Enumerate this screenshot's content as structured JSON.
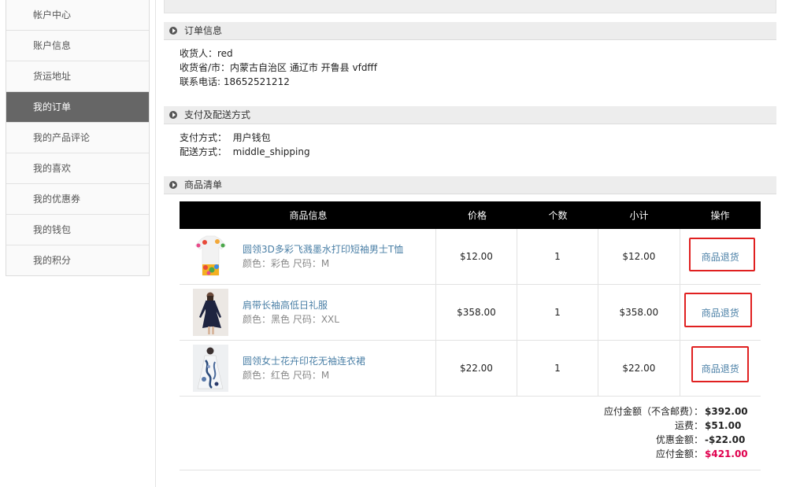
{
  "sidebar": {
    "items": [
      {
        "label": "帐户中心"
      },
      {
        "label": "账户信息"
      },
      {
        "label": "货运地址"
      },
      {
        "label": "我的订单"
      },
      {
        "label": "我的产品评论"
      },
      {
        "label": "我的喜欢"
      },
      {
        "label": "我的优惠券"
      },
      {
        "label": "我的钱包"
      },
      {
        "label": "我的积分"
      }
    ],
    "active": "我的订单"
  },
  "order_info": {
    "title": "订单信息",
    "consignee": "收货人：red",
    "region": "收货省/市：内蒙古自治区 通辽市 开鲁县 vfdfff",
    "phone": "联系电话: 18652521212"
  },
  "payment": {
    "title": "支付及配送方式",
    "pay_method": "支付方式：  用户钱包",
    "ship_method": "配送方式：  middle_shipping"
  },
  "goods": {
    "title": "商品清单",
    "headers": [
      "商品信息",
      "价格",
      "个数",
      "小计",
      "操作"
    ],
    "items": [
      {
        "name": "圆领3D多彩飞溅墨水打印短袖男士T恤",
        "attr": "颜色：彩色 尺码：M",
        "price": "$12.00",
        "qty": "1",
        "subtotal": "$12.00",
        "action": "商品退货"
      },
      {
        "name": "肩带长袖高低日礼服",
        "attr": "颜色：黑色 尺码：XXL",
        "price": "$358.00",
        "qty": "1",
        "subtotal": "$358.00",
        "action": "商品退货"
      },
      {
        "name": "圆领女士花卉印花无袖连衣裙",
        "attr": "颜色：红色 尺码：M",
        "price": "$22.00",
        "qty": "1",
        "subtotal": "$22.00",
        "action": "商品退货"
      }
    ]
  },
  "totals": {
    "subtotal_label": "应付金额（不含邮费）：",
    "subtotal": "$392.00",
    "shipping_label": "运费：",
    "shipping": "$51.00",
    "discount_label": "优惠金额：",
    "discount": "-$22.00",
    "total_label": "应付金额：",
    "total": "$421.00"
  },
  "colors": {
    "accent_link": "#4a7fa6",
    "highlight_box": "#e02020",
    "total_red": "#e0004e",
    "active_sidebar": "#666666"
  }
}
